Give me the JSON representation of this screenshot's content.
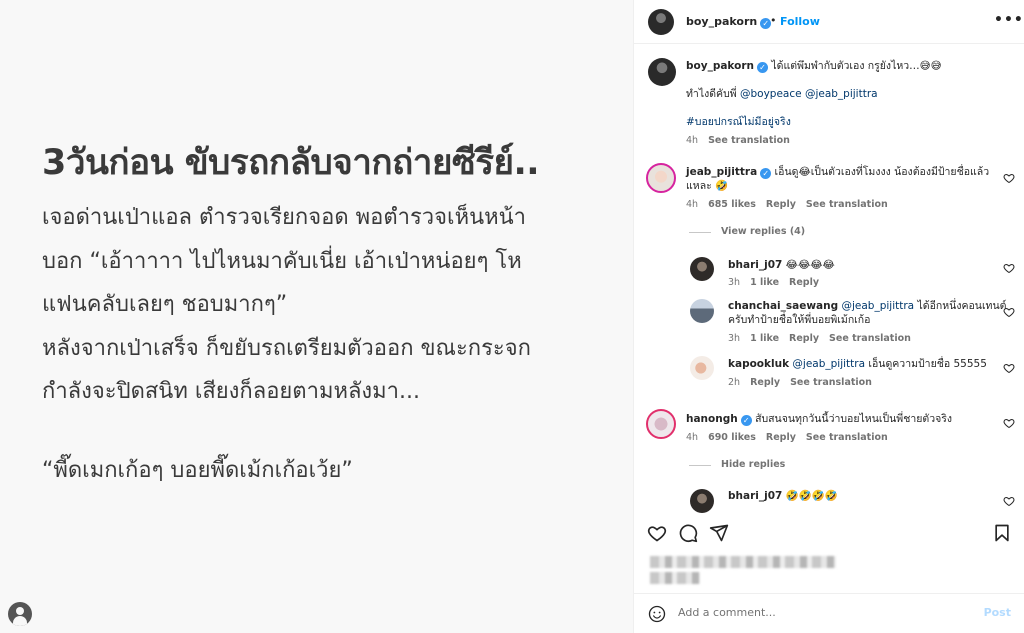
{
  "post_image": {
    "heading": "3วันก่อน ขับรถกลับจากถ่ายซีรีย์..",
    "body_lines": [
      "เจอด่านเป่าแอล ตำรวจเรียกจอด พอตำรวจเห็นหน้า",
      "บอก “เอ้าาาาา ไปไหนมาคับเนี่ย เอ้าเป่าหน่อยๆ โห",
      "แฟนคลับเลยๆ ชอบมากๆ”",
      "หลังจากเป่าเสร็จ ก็ขยับรถเตรียมตัวออก ขณะกระจก",
      "กำลังจะปิดสนิท เสียงก็ลอยตามหลังมา..."
    ],
    "quote": "“พี๊ดเมกเก้อๆ บอยพี๊ดเม้กเก้อเว้ย”"
  },
  "header": {
    "username": "boy_pakorn",
    "separator": "•",
    "follow_label": "Follow",
    "more_label": "•••"
  },
  "caption": {
    "username": "boy_pakorn",
    "text": "ได้แต่พึมพำกับตัวเอง กรูยังไหว…😅😅",
    "line2_text": "ทำไงดีคับพี่",
    "mention1": "@boypeace",
    "mention2": "@jeab_pijittra",
    "hashtag": "#บอยปกรณ์ไม่มีอยู่จริง",
    "time": "4h",
    "see_translation": "See translation"
  },
  "comments": [
    {
      "username": "jeab_pijittra",
      "text": "เอ็นดู😂เป็นตัวเองที่โมงงง น้องต้องมีป้ายชื่อแล้ว",
      "text_line2": "แหละ 🤣",
      "time": "4h",
      "likes": "685 likes",
      "reply": "Reply",
      "see_translation": "See translation",
      "view_replies": "View replies (4)"
    },
    {
      "username": "hanongh",
      "text": "สับสนจนทุกวันนี้ว่าบอยไหนเป็นพี่ชายตัวจริง",
      "time": "4h",
      "likes": "690 likes",
      "reply": "Reply",
      "see_translation": "See translation",
      "hide_replies": "Hide replies"
    }
  ],
  "replies": [
    {
      "username": "bhari_j07",
      "text": "😂😂😂😂",
      "time": "3h",
      "likes": "1 like",
      "reply": "Reply"
    },
    {
      "username": "chanchai_saewang",
      "mention": "@jeab_pijittra",
      "text": "ได้อีกหนึ่งคอนเทนต์",
      "text_line2": "ครับทำป้ายชื่อให้พี่บอยพิเม้กเก้อ",
      "time": "3h",
      "likes": "1 like",
      "reply": "Reply",
      "see_translation": "See translation"
    },
    {
      "username": "kapookluk",
      "mention": "@jeab_pijittra",
      "text": "เอ็นดูความป้ายชื่อ 55555",
      "time": "2h",
      "reply": "Reply",
      "see_translation": "See translation"
    },
    {
      "username": "bhari_j07",
      "text": "🤣🤣🤣🤣"
    }
  ],
  "add_comment": {
    "placeholder": "Add a comment...",
    "post_label": "Post"
  },
  "colors": {
    "link_blue": "#0095f6",
    "mention": "#00376b",
    "muted": "#737373"
  }
}
